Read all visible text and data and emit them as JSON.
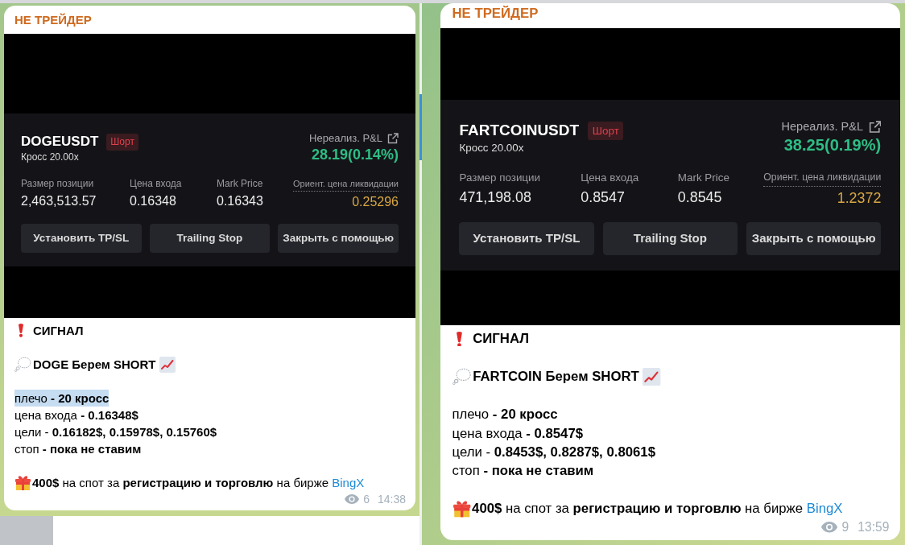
{
  "cards": [
    {
      "channel": "НЕ ТРЕЙДЕР",
      "position": {
        "symbol": "DOGEUSDT",
        "side": "Шорт",
        "margin_mode": "Кросс 20.00x",
        "pnl_label": "Нереализ. P&L",
        "pnl": "28.19(0.14%)",
        "stats": [
          {
            "kind": "plain",
            "label": "Размер позиции",
            "value": "2,463,513.57"
          },
          {
            "kind": "plain",
            "label": "Цена входа",
            "value": "0.16348"
          },
          {
            "kind": "plain",
            "label": "Mark Price",
            "value": "0.16343"
          },
          {
            "kind": "liquidation",
            "label": "Ориент. цена ликвидации",
            "value": "0.25296"
          }
        ],
        "buttons": [
          "Установить TP/SL",
          "Trailing Stop",
          "Закрыть с помощью"
        ]
      },
      "message": {
        "title": "СИГНАЛ",
        "headline": "DOGE Берем SHORT",
        "lines": [
          {
            "text": "плечо **- 20 кросс**",
            "highlighted": true
          },
          {
            "text": "цена входа **- 0.16348$**",
            "highlighted": false
          },
          {
            "text": "цели - **0.16182$, 0.15978$, 0.15760$**",
            "highlighted": false
          },
          {
            "text": "стоп **- пока не ставим**",
            "highlighted": false
          }
        ],
        "promo": "**400$** на спот за **регистрацию и торговлю** на бирже",
        "link": "BingX",
        "views": "6",
        "time": "14:38"
      }
    },
    {
      "channel": "НЕ ТРЕЙДЕР",
      "position": {
        "symbol": "FARTCOINUSDT",
        "side": "Шорт",
        "margin_mode": "Кросс 20.00x",
        "pnl_label": "Нереализ. P&L",
        "pnl": "38.25(0.19%)",
        "stats": [
          {
            "kind": "plain",
            "label": "Размер позиции",
            "value": "471,198.08"
          },
          {
            "kind": "plain",
            "label": "Цена входа",
            "value": "0.8547"
          },
          {
            "kind": "plain",
            "label": "Mark Price",
            "value": "0.8545"
          },
          {
            "kind": "liquidation",
            "label": "Ориент. цена ликвидации",
            "value": "1.2372"
          }
        ],
        "buttons": [
          "Установить TP/SL",
          "Trailing Stop",
          "Закрыть с помощью"
        ]
      },
      "message": {
        "title": "СИГНАЛ",
        "headline": "FARTCOIN Берем SHORT",
        "lines": [
          {
            "text": "плечо **- 20 кросс**",
            "highlighted": false
          },
          {
            "text": "цена входа **- 0.8547$**",
            "highlighted": false
          },
          {
            "text": "цели - **0.8453$, 0.8287$, 0.8061$**",
            "highlighted": false
          },
          {
            "text": "стоп **- пока не ставим**",
            "highlighted": false
          }
        ],
        "promo": "**400$** на спот за **регистрацию и торговлю** на бирже",
        "link": "BingX",
        "views": "9",
        "time": "13:59"
      }
    }
  ]
}
